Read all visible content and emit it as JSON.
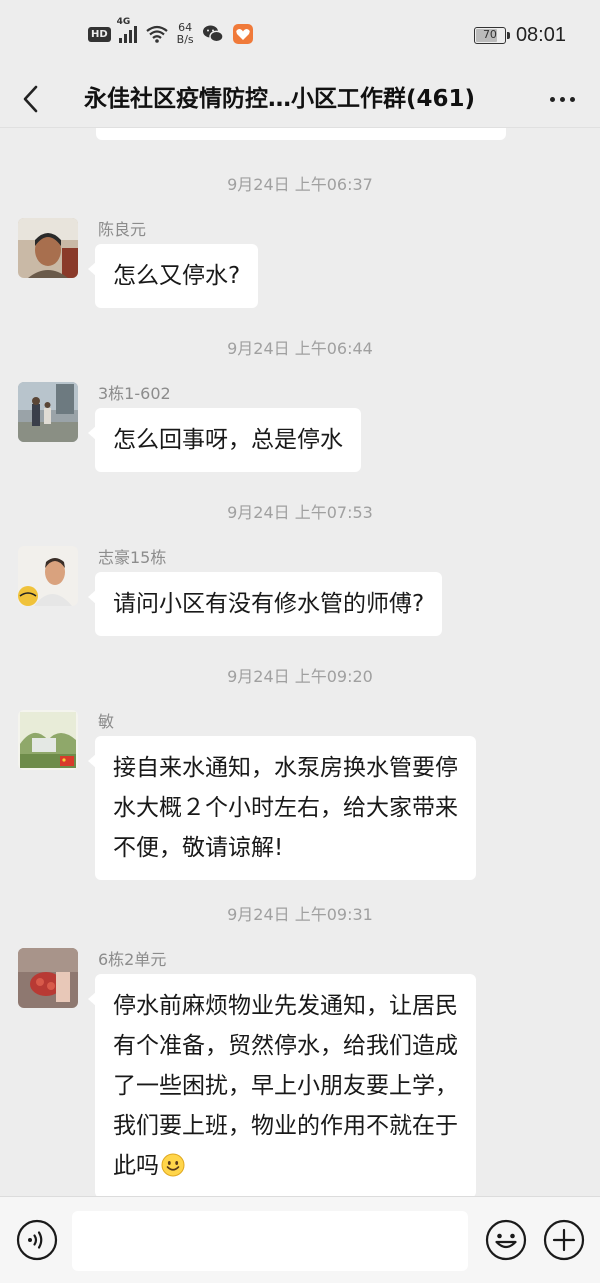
{
  "status_bar": {
    "hd": "HD",
    "network": "4G",
    "speed_value": "64",
    "speed_unit": "B/s",
    "battery": "70",
    "time": "08:01"
  },
  "header": {
    "title": "永佳社区疫情防控…小区工作群(461)"
  },
  "messages": [
    {
      "timestamp": "9月24日 上午06:37",
      "sender": "陈良元",
      "text": "怎么又停水?"
    },
    {
      "timestamp": "9月24日 上午06:44",
      "sender": "3栋1-602",
      "text": "怎么回事呀，总是停水"
    },
    {
      "timestamp": "9月24日 上午07:53",
      "sender": "志豪15栋",
      "text": "请问小区有没有修水管的师傅?"
    },
    {
      "timestamp": "9月24日 上午09:20",
      "sender": "敏",
      "lines": [
        "接自来水通知，水泵房换水管要停",
        "水大概２个小时左右，给大家带来",
        "不便，敬请谅解!"
      ]
    },
    {
      "timestamp": "9月24日 上午09:31",
      "sender": "6栋2单元",
      "lines": [
        "停水前麻烦物业先发通知，让居民",
        "有个准备，贸然停水，给我们造成",
        "了一些困扰，早上小朋友要上学，",
        "我们要上班，物业的作用不就在于",
        "此吗"
      ],
      "emoji": "smile-emoji"
    }
  ],
  "input": {
    "value": ""
  },
  "colors": {
    "background": "#ededed",
    "bubble": "#ffffff",
    "timestamp": "#a0a0a0",
    "sender": "#8c8c8c"
  },
  "icons": {
    "back": "back-chevron-icon",
    "more": "more-dots-icon",
    "voice": "voice-icon",
    "emoji": "emoji-icon",
    "plus": "plus-icon"
  }
}
